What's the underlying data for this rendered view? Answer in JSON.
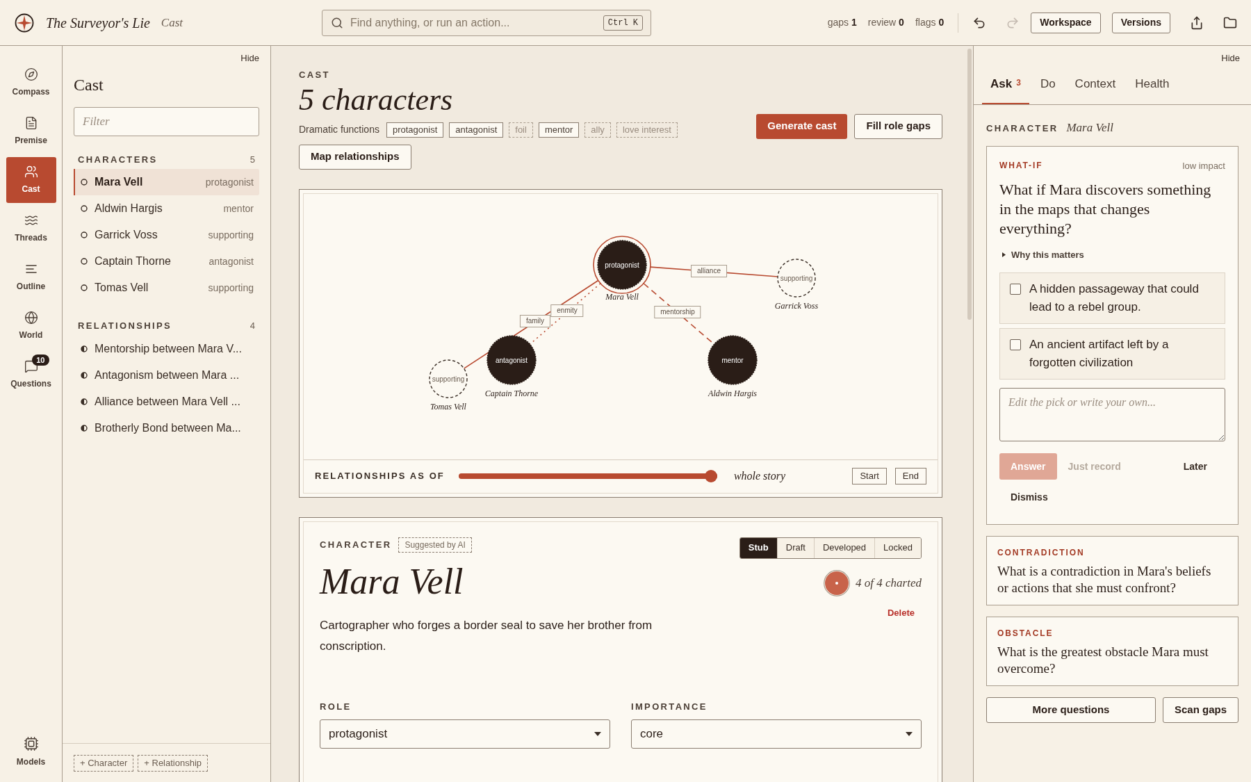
{
  "topbar": {
    "title": "The Surveyor's Lie",
    "section": "Cast",
    "search": {
      "placeholder": "Find anything, or run an action...",
      "shortcut": "Ctrl K"
    },
    "counters": [
      {
        "label": "gaps",
        "value": "1"
      },
      {
        "label": "review",
        "value": "0"
      },
      {
        "label": "flags",
        "value": "0"
      }
    ],
    "undo": {
      "disabled": false
    },
    "redo": {
      "disabled": true
    },
    "buttons": [
      "Workspace",
      "Versions"
    ]
  },
  "rail": {
    "items": [
      {
        "label": "Compass",
        "selected": false
      },
      {
        "label": "Premise",
        "selected": false
      },
      {
        "label": "Cast",
        "selected": true
      },
      {
        "label": "Threads",
        "selected": false
      },
      {
        "label": "Outline",
        "selected": false
      },
      {
        "label": "World",
        "selected": false
      },
      {
        "label": "Questions",
        "selected": false,
        "badge": "10"
      }
    ],
    "footer": {
      "label": "Models"
    }
  },
  "sidebar": {
    "hide": "Hide",
    "title": "Cast",
    "filter": {
      "placeholder": "Filter"
    },
    "characters": {
      "heading": "CHARACTERS",
      "count": "5",
      "items": [
        {
          "name": "Mara Vell",
          "role": "protagonist",
          "selected": true
        },
        {
          "name": "Aldwin Hargis",
          "role": "mentor",
          "selected": false
        },
        {
          "name": "Garrick Voss",
          "role": "supporting",
          "selected": false
        },
        {
          "name": "Captain Thorne",
          "role": "antagonist",
          "selected": false
        },
        {
          "name": "Tomas Vell",
          "role": "supporting",
          "selected": false
        }
      ]
    },
    "relationships": {
      "heading": "RELATIONSHIPS",
      "count": "4",
      "items": [
        {
          "label": "Mentorship between Mara V...",
          "selected": false
        },
        {
          "label": "Antagonism between Mara ...",
          "selected": false
        },
        {
          "label": "Alliance between Mara Vell ...",
          "selected": false
        },
        {
          "label": "Brotherly Bond between Ma...",
          "selected": false
        }
      ]
    },
    "footer_buttons": [
      "+ Character",
      "+ Relationship"
    ]
  },
  "main": {
    "eyebrow": "CAST",
    "title": "5 characters",
    "functions_label": "Dramatic functions",
    "functions": [
      {
        "label": "protagonist",
        "filled": true
      },
      {
        "label": "antagonist",
        "filled": true
      },
      {
        "label": "foil",
        "filled": false
      },
      {
        "label": "mentor",
        "filled": true
      },
      {
        "label": "ally",
        "filled": false
      },
      {
        "label": "love interest",
        "filled": false
      }
    ],
    "primary_button": "Generate cast",
    "secondary_button": "Fill role gaps",
    "map_button": "Map relationships",
    "graph": {
      "nodes": [
        {
          "name": "Mara Vell",
          "role": "protagonist",
          "kind": "core",
          "selected": true
        },
        {
          "name": "Garrick Voss",
          "role": "supporting",
          "kind": "minor",
          "selected": false
        },
        {
          "name": "Captain Thorne",
          "role": "antagonist",
          "kind": "core",
          "selected": false
        },
        {
          "name": "Aldwin Hargis",
          "role": "mentor",
          "kind": "core",
          "selected": false
        },
        {
          "name": "Tomas Vell",
          "role": "supporting",
          "kind": "minor",
          "selected": false
        }
      ],
      "edges": [
        {
          "label": "alliance",
          "kind": "solid"
        },
        {
          "label": "mentorship",
          "kind": "dashed"
        },
        {
          "label": "enmity",
          "kind": "dotted"
        },
        {
          "label": "family",
          "kind": "solid"
        }
      ],
      "timeline": {
        "label": "RELATIONSHIPS AS OF",
        "level": 1,
        "reading": "whole story",
        "buttons": [
          "Start",
          "End"
        ]
      }
    },
    "character": {
      "eyebrow": "CHARACTER",
      "badge": "Suggested by AI",
      "name": "Mara Vell",
      "stages": [
        {
          "label": "Stub",
          "selected": true
        },
        {
          "label": "Draft",
          "selected": false
        },
        {
          "label": "Developed",
          "selected": false
        },
        {
          "label": "Locked",
          "selected": false
        }
      ],
      "progress": {
        "level": 1,
        "reading": "4 of 4 charted"
      },
      "delete": "Delete",
      "description": "Cartographer who forges a border seal to save her brother from conscription.",
      "fields": [
        {
          "label": "ROLE",
          "value": "protagonist"
        },
        {
          "label": "IMPORTANCE",
          "value": "core"
        }
      ]
    }
  },
  "assistant": {
    "hide": "Hide",
    "tabs": [
      {
        "label": "Ask",
        "badge": "3",
        "selected": true
      },
      {
        "label": "Do",
        "selected": false
      },
      {
        "label": "Context",
        "selected": false
      },
      {
        "label": "Health",
        "selected": false
      }
    ],
    "context_label": "CHARACTER",
    "context_value": "Mara Vell",
    "active": {
      "kind_label": "WHAT-IF",
      "impact": "low impact",
      "question": "What if Mara discovers something in the maps that changes everything?",
      "disclosure": "Why this matters",
      "options": [
        {
          "text": "A hidden passageway that could lead to a rebel group.",
          "checked": false
        },
        {
          "text": "An ancient artifact left by a forgotten civilization",
          "checked": false
        }
      ],
      "answer_placeholder": "Edit the pick or write your own...",
      "actions": [
        {
          "label": "Answer",
          "kind": "primary",
          "disabled": true
        },
        {
          "label": "Just record",
          "kind": "text",
          "disabled": true
        },
        {
          "label": "Later",
          "kind": "text",
          "disabled": false
        },
        {
          "label": "Dismiss",
          "kind": "text",
          "disabled": false
        }
      ]
    },
    "questions": [
      {
        "kind_label": "CONTRADICTION",
        "question": "What is a contradiction in Mara's beliefs or actions that she must confront?"
      },
      {
        "kind_label": "OBSTACLE",
        "question": "What is the greatest obstacle Mara must overcome?"
      }
    ],
    "buttons": [
      "More questions",
      "Scan gaps"
    ]
  }
}
